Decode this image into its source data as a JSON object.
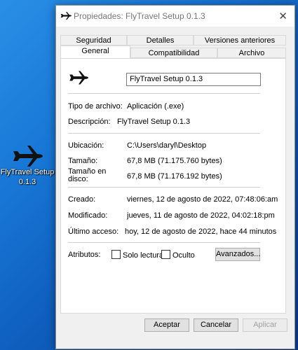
{
  "desktop": {
    "icon_label_line1": "FlyTravel Setup",
    "icon_label_line2": "0.1.3",
    "icon": "airplane-icon"
  },
  "window": {
    "title": "Propiedades: FlyTravel Setup 0.1.3",
    "close_glyph": "✕",
    "icon": "airplane-icon"
  },
  "tabs": {
    "seguridad": "Seguridad",
    "detalles": "Detalles",
    "versiones": "Versiones anteriores",
    "general": "General",
    "compatibilidad": "Compatibilidad",
    "archivo": "Archivo"
  },
  "general": {
    "file_name": "FlyTravel Setup 0.1.3",
    "tipo_label": "Tipo de archivo:",
    "tipo_value": "Aplicación (.exe)",
    "descripcion_label": "Descripción:",
    "descripcion_value": "FlyTravel Setup 0.1.3",
    "ubicacion_label": "Ubicación:",
    "ubicacion_value": "C:\\Users\\daryl\\Desktop",
    "tamano_label": "Tamaño:",
    "tamano_value": "67,8 MB (71.175.760 bytes)",
    "tamano_disco_label_1": "Tamaño en",
    "tamano_disco_label_2": "disco:",
    "tamano_disco_value": "67,8 MB (71.176.192 bytes)",
    "creado_label": "Creado:",
    "creado_value": "viernes, 12 de agosto de 2022, 07:48:06:am",
    "modificado_label": "Modificado:",
    "modificado_value": "jueves, 11 de agosto de 2022, 04:02:18:pm",
    "ultimo_label": "Último acceso:",
    "ultimo_value": "hoy, 12 de agosto de 2022, hace 44 minutos",
    "atributos_label": "Atributos:",
    "solo_lectura": "Solo lectura",
    "oculto": "Oculto",
    "avanzados": "Avanzados..."
  },
  "buttons": {
    "aceptar": "Aceptar",
    "cancelar": "Cancelar",
    "aplicar": "Aplicar"
  }
}
